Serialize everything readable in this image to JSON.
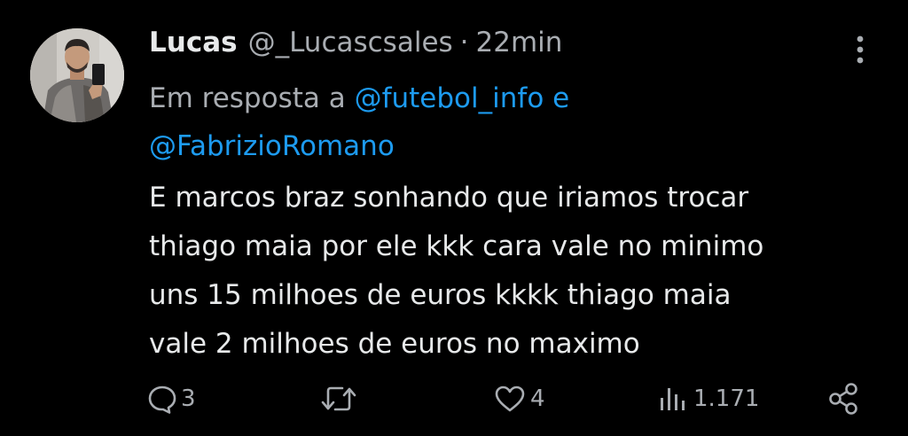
{
  "tweet": {
    "author_name": "Lucas",
    "author_handle": "@_Lucascsales",
    "separator": "·",
    "time": "22min",
    "reply_prefix": "Em resposta a",
    "mention_1": "@futebol_info",
    "reply_joiner": "e",
    "mention_2": "@FabrizioRomano",
    "text": "E marcos braz sonhando que iriamos trocar\nthiago maia por ele kkk cara vale no minimo\nuns 15 milhoes de euros kkkk thiago maia\nvale 2 milhoes de euros no maximo"
  },
  "actions": {
    "replies": "3",
    "likes": "4",
    "views": "1.171"
  },
  "icons": {
    "more": "more-vertical-icon",
    "reply": "reply-bubble-icon",
    "retweet": "retweet-icon",
    "like": "heart-icon",
    "views": "views-bars-icon",
    "share": "share-icon"
  },
  "colors": {
    "background": "#000000",
    "text": "#e7e9ea",
    "muted": "#a9adb2",
    "link": "#1d9bf0"
  }
}
